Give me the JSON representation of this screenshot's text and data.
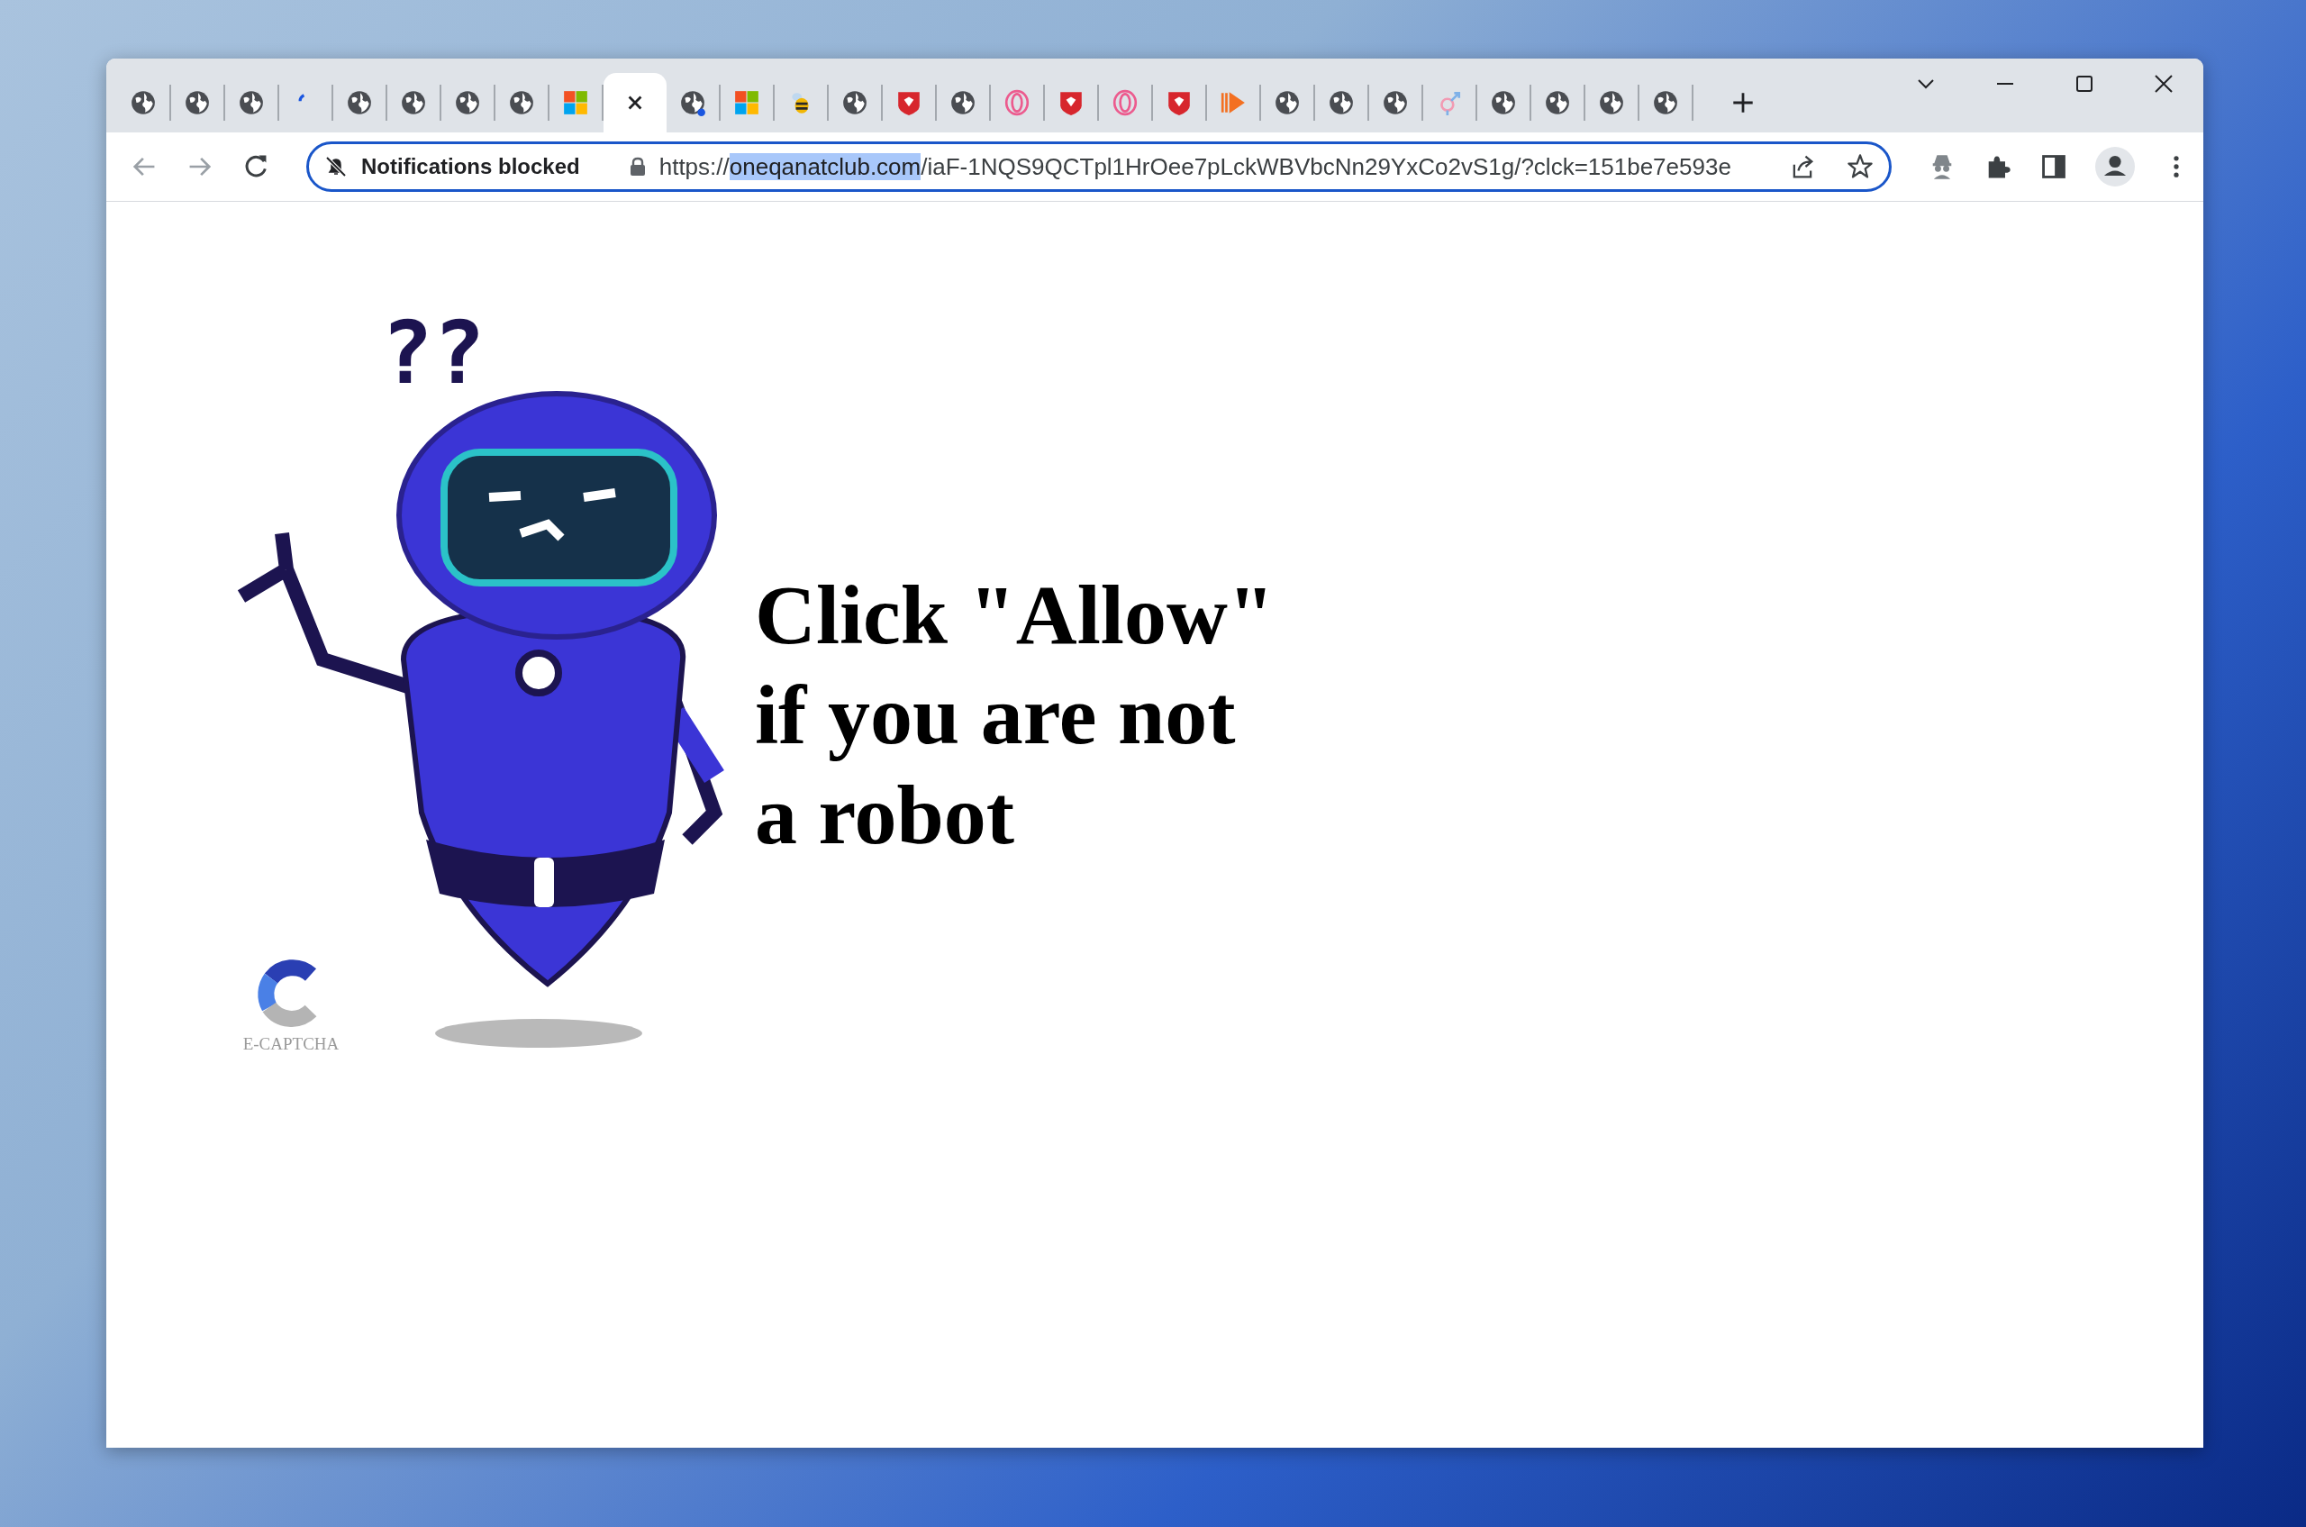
{
  "tabs": [
    {
      "kind": "globe",
      "selected": false
    },
    {
      "kind": "globe",
      "selected": false
    },
    {
      "kind": "globe",
      "selected": false
    },
    {
      "kind": "loading",
      "selected": false
    },
    {
      "kind": "globe",
      "selected": false
    },
    {
      "kind": "globe",
      "selected": false
    },
    {
      "kind": "globe",
      "selected": false
    },
    {
      "kind": "globe",
      "selected": false
    },
    {
      "kind": "windows",
      "selected": false
    },
    {
      "kind": "close",
      "selected": true
    },
    {
      "kind": "globe-dot",
      "selected": false
    },
    {
      "kind": "windows",
      "selected": false
    },
    {
      "kind": "bee",
      "selected": false
    },
    {
      "kind": "globe",
      "selected": false
    },
    {
      "kind": "shield",
      "selected": false
    },
    {
      "kind": "globe",
      "selected": false
    },
    {
      "kind": "opera",
      "selected": false
    },
    {
      "kind": "shield",
      "selected": false
    },
    {
      "kind": "opera",
      "selected": false
    },
    {
      "kind": "shield",
      "selected": false
    },
    {
      "kind": "play",
      "selected": false
    },
    {
      "kind": "globe",
      "selected": false
    },
    {
      "kind": "globe",
      "selected": false
    },
    {
      "kind": "globe",
      "selected": false
    },
    {
      "kind": "gender",
      "selected": false
    },
    {
      "kind": "globe",
      "selected": false
    },
    {
      "kind": "globe",
      "selected": false
    },
    {
      "kind": "globe",
      "selected": false
    },
    {
      "kind": "globe",
      "selected": false
    }
  ],
  "toolbar": {
    "notification_chip": "Notifications blocked",
    "url": {
      "scheme": "https://",
      "host": "oneqanatclub.com",
      "host_selected": true,
      "path": "/iaF-1NQS9QCTpl1HrOee7pLckWBVbcNn29YxCo2vS1g/?clck=151be7e593e"
    }
  },
  "page": {
    "thought": "??",
    "headline": [
      "Click \"Allow\"",
      "if you are not",
      "a robot"
    ],
    "logo_caption": "E-CAPTCHA"
  }
}
